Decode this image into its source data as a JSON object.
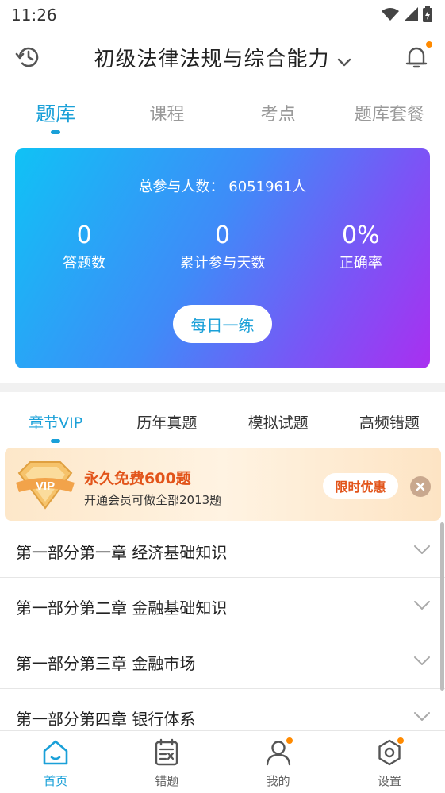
{
  "status_bar": {
    "time": "11:26"
  },
  "header": {
    "title": "初级法律法规与综合能力"
  },
  "top_tabs": [
    {
      "label": "题库",
      "active": true
    },
    {
      "label": "课程",
      "active": false
    },
    {
      "label": "考点",
      "active": false
    },
    {
      "label": "题库套餐",
      "active": false
    }
  ],
  "card": {
    "total_participants": "总参与人数： 6051961人",
    "stats": [
      {
        "value": "0",
        "label": "答题数"
      },
      {
        "value": "0",
        "label": "累计参与天数"
      },
      {
        "value": "0%",
        "label": "正确率"
      }
    ],
    "daily_button": "每日一练"
  },
  "sub_tabs": [
    {
      "label": "章节VIP",
      "active": true
    },
    {
      "label": "历年真题",
      "active": false
    },
    {
      "label": "模拟试题",
      "active": false
    },
    {
      "label": "高频错题",
      "active": false
    }
  ],
  "banner": {
    "badge": "VIP",
    "headline": "永久免费600题",
    "subline": "开通会员可做全部2013题",
    "cta": "限时优惠"
  },
  "chapters": [
    "第一部分第一章 经济基础知识",
    "第一部分第二章 金融基础知识",
    "第一部分第三章 金融市场",
    "第一部分第四章 银行体系"
  ],
  "bottom_nav": [
    {
      "label": "首页",
      "icon": "home-icon",
      "active": true,
      "badge": false
    },
    {
      "label": "错题",
      "icon": "wrong-questions-icon",
      "active": false,
      "badge": false
    },
    {
      "label": "我的",
      "icon": "profile-icon",
      "active": false,
      "badge": true
    },
    {
      "label": "设置",
      "icon": "settings-icon",
      "active": false,
      "badge": true
    }
  ],
  "colors": {
    "accent": "#1aa0d8",
    "badge": "#ff8a00",
    "promo": "#e2541a"
  }
}
